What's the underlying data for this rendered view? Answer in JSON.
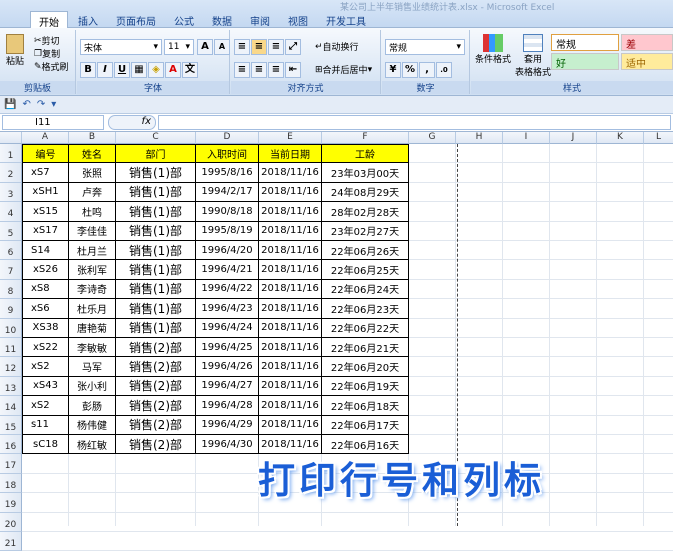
{
  "window": {
    "title": "某公司上半年销售业绩统计表.xlsx - Microsoft Excel"
  },
  "tabs": [
    "开始",
    "插入",
    "页面布局",
    "公式",
    "数据",
    "审阅",
    "视图",
    "开发工具"
  ],
  "ribbon": {
    "clipboard": {
      "label": "剪贴板",
      "paste": "粘贴",
      "cut": "剪切",
      "copy": "复制",
      "format_painter": "格式刷"
    },
    "font": {
      "label": "字体",
      "name": "宋体",
      "size": "11",
      "grow": "A",
      "shrink": "A",
      "bold": "B",
      "italic": "I",
      "underline": "U",
      "wen": "文"
    },
    "alignment": {
      "label": "对齐方式",
      "wrap": "自动换行",
      "merge": "合并后居中"
    },
    "number": {
      "label": "数字",
      "format": "常规",
      "percent": "%",
      "comma": ",",
      "inc": ".0",
      "dec": ".00"
    },
    "styles": {
      "label": "样式",
      "conditional": "条件格式",
      "table": "套用\n表格格式",
      "normal": "常规",
      "bad": "差",
      "good": "好",
      "neutral": "适中"
    }
  },
  "formula_bar": {
    "name_box": "I11",
    "fx": "fx",
    "value": ""
  },
  "columns": [
    "A",
    "B",
    "C",
    "D",
    "E",
    "F",
    "G",
    "H",
    "I",
    "J",
    "K",
    "L"
  ],
  "rows": [
    "1",
    "2",
    "3",
    "4",
    "5",
    "6",
    "7",
    "8",
    "9",
    "10",
    "11",
    "12",
    "13",
    "14",
    "15",
    "16",
    "17",
    "18",
    "19",
    "20",
    "21"
  ],
  "table": {
    "headers": [
      "编号",
      "姓名",
      "部门",
      "入职时间",
      "当前日期",
      "工龄"
    ],
    "rows": [
      [
        "xS7",
        "张照",
        "销售(1)部",
        "1995/8/16",
        "2018/11/16",
        "23年03月00天"
      ],
      [
        "xSH1",
        "卢奔",
        "销售(1)部",
        "1994/2/17",
        "2018/11/16",
        "24年08月29天"
      ],
      [
        "xS15",
        "杜鸣",
        "销售(1)部",
        "1990/8/18",
        "2018/11/16",
        "28年02月28天"
      ],
      [
        "xS17",
        "李佳佳",
        "销售(1)部",
        "1995/8/19",
        "2018/11/16",
        "23年02月27天"
      ],
      [
        "S14",
        "杜月兰",
        "销售(1)部",
        "1996/4/20",
        "2018/11/16",
        "22年06月26天"
      ],
      [
        "xS26",
        "张利军",
        "销售(1)部",
        "1996/4/21",
        "2018/11/16",
        "22年06月25天"
      ],
      [
        "xS8",
        "李诗奇",
        "销售(1)部",
        "1996/4/22",
        "2018/11/16",
        "22年06月24天"
      ],
      [
        "xS6",
        "杜乐月",
        "销售(1)部",
        "1996/4/23",
        "2018/11/16",
        "22年06月23天"
      ],
      [
        "XS38",
        "唐艳菊",
        "销售(1)部",
        "1996/4/24",
        "2018/11/16",
        "22年06月22天"
      ],
      [
        "xS22",
        "李敏敏",
        "销售(2)部",
        "1996/4/25",
        "2018/11/16",
        "22年06月21天"
      ],
      [
        "xS2",
        "马军",
        "销售(2)部",
        "1996/4/26",
        "2018/11/16",
        "22年06月20天"
      ],
      [
        "xS43",
        "张小利",
        "销售(2)部",
        "1996/4/27",
        "2018/11/16",
        "22年06月19天"
      ],
      [
        "xS2",
        "彭肠",
        "销售(2)部",
        "1996/4/28",
        "2018/11/16",
        "22年06月18天"
      ],
      [
        "s11",
        "杨伟健",
        "销售(2)部",
        "1996/4/29",
        "2018/11/16",
        "22年06月17天"
      ],
      [
        "sC18",
        "杨红敏",
        "销售(2)部",
        "1996/4/30",
        "2018/11/16",
        "22年06月16天"
      ]
    ]
  },
  "overlay_text": "打印行号和列标",
  "colors": {
    "header_fill": "#ffff00",
    "overlay": "#1a5ed6",
    "ribbon": "#dbe7f5"
  }
}
